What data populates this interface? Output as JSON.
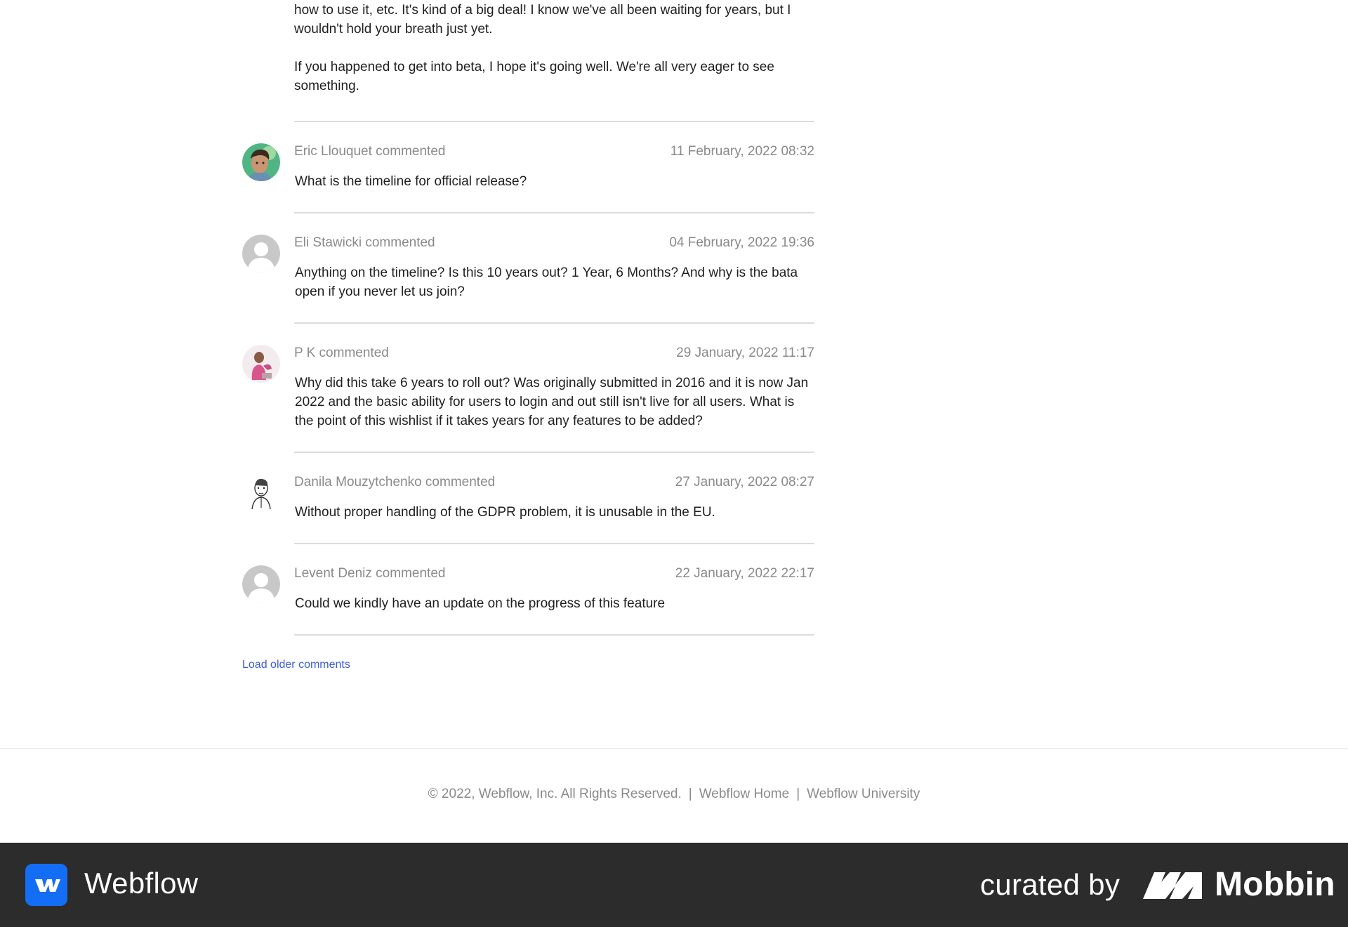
{
  "intro": {
    "paragraph_1": "how to use it, etc. It's kind of a big deal! I know we've all been waiting for years, but I wouldn't hold your breath just yet.",
    "paragraph_2": "If you happened to get into beta, I hope it's going well. We're all very eager to see something."
  },
  "comments": [
    {
      "author": "Eric Llouquet commented",
      "date": "11 February, 2022 08:32",
      "text": "What is the timeline for official release?",
      "avatar": "photo-avatar"
    },
    {
      "author": "Eli Stawicki commented",
      "date": "04 February, 2022 19:36",
      "text": "Anything on the timeline? Is this 10 years out? 1 Year, 6 Months? And why is the bata open if you never let us join?",
      "avatar": "default-avatar"
    },
    {
      "author": "P K commented",
      "date": "29 January, 2022 11:17",
      "text": "Why did this take 6 years to roll out? Was originally submitted in 2016 and it is now Jan 2022 and the basic ability for users to login and out still isn't live for all users. What is the point of this wishlist if it takes years for any features to be added?",
      "avatar": "photo-avatar"
    },
    {
      "author": "Danila Mouzytchenko commented",
      "date": "27 January, 2022 08:27",
      "text": "Without proper handling of the GDPR problem, it is unusable in the EU.",
      "avatar": "sketch-avatar"
    },
    {
      "author": "Levent Deniz commented",
      "date": "22 January, 2022 22:17",
      "text": "Could we kindly have an update on the progress of this feature",
      "avatar": "default-avatar"
    }
  ],
  "load_older": "Load older comments",
  "footer": {
    "copyright": "© 2022, Webflow, Inc. All Rights Reserved.",
    "separator": "|",
    "link_home": "Webflow Home",
    "link_university": "Webflow University"
  },
  "bottom_bar": {
    "app_name": "Webflow",
    "curated_by": "curated by",
    "curator": "Mobbin"
  },
  "colors": {
    "link": "#3b5bdb",
    "muted_text": "#8a8a8a",
    "webflow_blue": "#146ef5",
    "bottom_bar_bg": "#2c2c2c"
  }
}
